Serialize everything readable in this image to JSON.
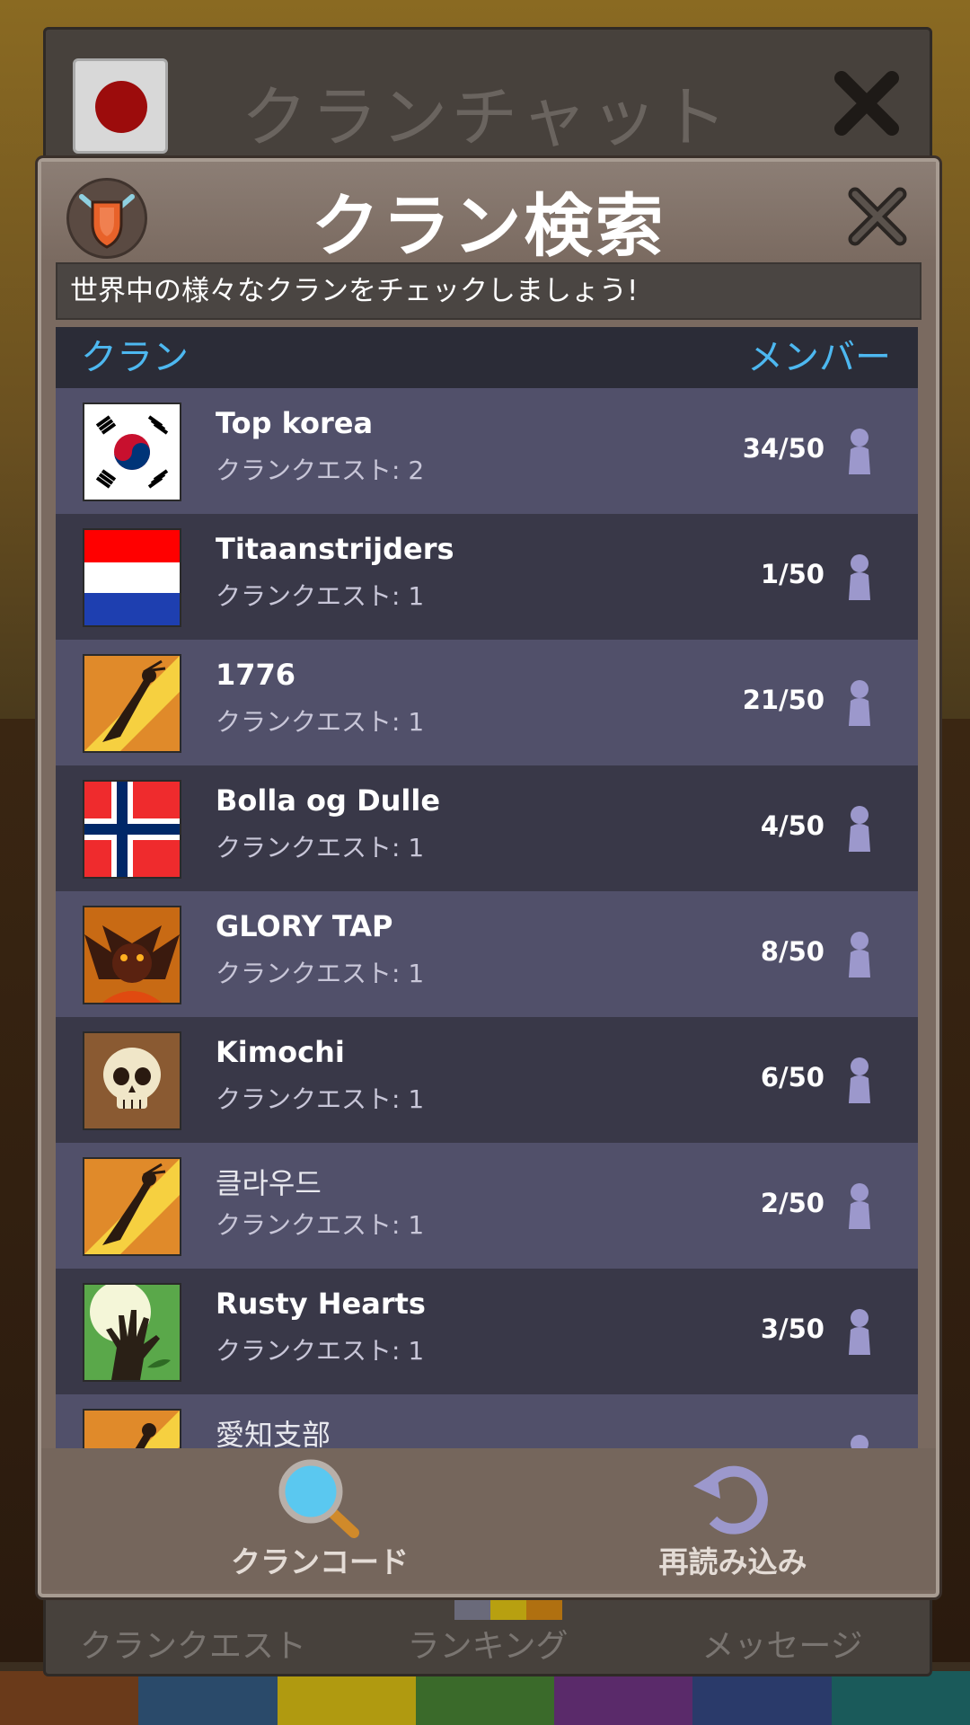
{
  "background": {
    "chat_window": {
      "title": "クランチャット",
      "tabs": [
        "クランクエスト",
        "ランキング",
        "メッセージ"
      ]
    }
  },
  "modal": {
    "title": "クラン検索",
    "subtitle": "世界中の様々なクランをチェックしましょう!",
    "columns": {
      "clan": "クラン",
      "members": "メンバー"
    },
    "clans": [
      {
        "name": "Top korea",
        "quest": "クランクエスト: 2",
        "members": "34/50",
        "icon": "flag-south-korea-icon"
      },
      {
        "name": "Titaanstrijders",
        "quest": "クランクエスト: 1",
        "members": "1/50",
        "icon": "flag-netherlands-icon"
      },
      {
        "name": "1776",
        "quest": "クランクエスト: 1",
        "members": "21/50",
        "icon": "warrior-emblem-icon"
      },
      {
        "name": "Bolla og Dulle",
        "quest": "クランクエスト: 1",
        "members": "4/50",
        "icon": "flag-norway-icon"
      },
      {
        "name": "GLORY TAP",
        "quest": "クランクエスト: 1",
        "members": "8/50",
        "icon": "demon-emblem-icon"
      },
      {
        "name": "Kimochi",
        "quest": "クランクエスト: 1",
        "members": "6/50",
        "icon": "skull-emblem-icon"
      },
      {
        "name": "클라우드",
        "quest": "クランクエスト: 1",
        "members": "2/50",
        "icon": "warrior-emblem-icon"
      },
      {
        "name": "Rusty Hearts",
        "quest": "クランクエスト: 1",
        "members": "3/50",
        "icon": "zombie-hand-emblem-icon"
      },
      {
        "name": "愛知支部",
        "quest": "",
        "members": "",
        "icon": "warrior-emblem-icon"
      }
    ],
    "footer": {
      "clan_code_label": "クランコード",
      "reload_label": "再読み込み"
    }
  },
  "colors": {
    "accent_blue": "#4db8f0",
    "row_light": "#51506a",
    "row_dark": "#393848",
    "member_icon": "#9c98cc"
  }
}
